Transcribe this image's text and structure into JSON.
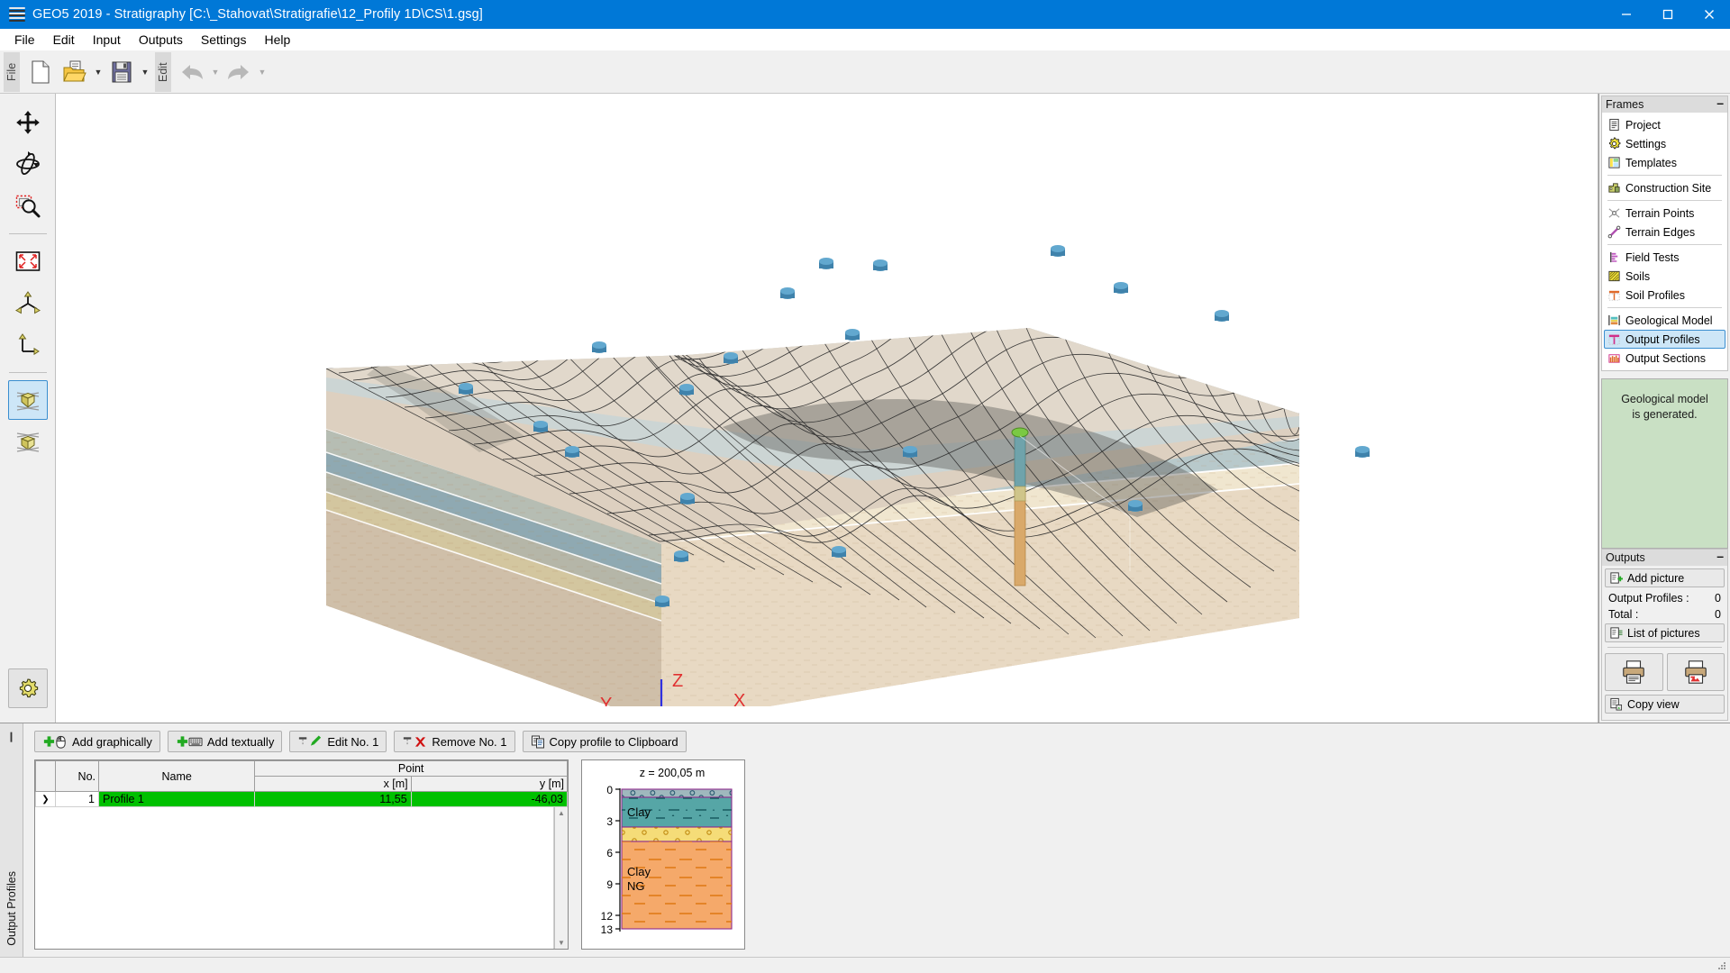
{
  "window": {
    "title": "GEO5 2019 - Stratigraphy [C:\\_Stahovat\\Stratigrafie\\12_Profily 1D\\CS\\1.gsg]",
    "app_icon": "geo5-stack-icon",
    "minimize": "—",
    "maximize": "☐",
    "close": "✕"
  },
  "menu": {
    "items": [
      "File",
      "Edit",
      "Input",
      "Outputs",
      "Settings",
      "Help"
    ]
  },
  "toolbar": {
    "groups": [
      {
        "label": "File",
        "buttons": [
          "new-file-icon",
          "open-folder-icon",
          "save-floppy-icon"
        ]
      },
      {
        "label": "Edit",
        "buttons": [
          "undo-arrow-icon",
          "redo-arrow-icon"
        ]
      }
    ]
  },
  "left_toolbar": {
    "items": [
      {
        "name": "pan-tool",
        "icon": "move-arrows-icon",
        "active": false
      },
      {
        "name": "rotate-tool",
        "icon": "rotate-3d-icon",
        "active": false
      },
      {
        "name": "zoom-window-tool",
        "icon": "zoom-window-icon",
        "active": false
      },
      {
        "name": "zoom-all-tool",
        "icon": "zoom-extents-icon",
        "active": false
      },
      {
        "name": "axonometric-view",
        "icon": "axes-3d-icon",
        "active": false
      },
      {
        "name": "plan-view",
        "icon": "axes-2d-icon",
        "active": false
      },
      {
        "name": "view-top-cut",
        "icon": "cube-top-cut-icon",
        "active": true
      },
      {
        "name": "view-full-cube",
        "icon": "cube-solid-icon",
        "active": false
      }
    ],
    "settings": {
      "name": "view-settings",
      "icon": "gear-icon"
    }
  },
  "canvas": {
    "axes": {
      "x": "X",
      "y": "Y",
      "z": "Z"
    },
    "x_color": "#e03030",
    "y_color": "#18a018",
    "z_color": "#3030e0",
    "borehole_marker_color": "#7ac943",
    "test_point_color": "#3f87b5"
  },
  "frames_panel": {
    "title": "Frames",
    "minimize": "–",
    "items": [
      {
        "label": "Project",
        "icon": "document-icon",
        "selected": false,
        "sep_after": false
      },
      {
        "label": "Settings",
        "icon": "gear-icon",
        "selected": false,
        "sep_after": false
      },
      {
        "label": "Templates",
        "icon": "template-icon",
        "selected": false,
        "sep_after": true
      },
      {
        "label": "Construction Site",
        "icon": "construction-site-icon",
        "selected": false,
        "sep_after": true
      },
      {
        "label": "Terrain Points",
        "icon": "terrain-points-icon",
        "selected": false,
        "sep_after": false
      },
      {
        "label": "Terrain Edges",
        "icon": "terrain-edges-icon",
        "selected": false,
        "sep_after": true
      },
      {
        "label": "Field Tests",
        "icon": "field-tests-icon",
        "selected": false,
        "sep_after": false
      },
      {
        "label": "Soils",
        "icon": "soils-hatch-icon",
        "selected": false,
        "sep_after": false
      },
      {
        "label": "Soil Profiles",
        "icon": "soil-profile-icon",
        "selected": false,
        "sep_after": true
      },
      {
        "label": "Geological Model",
        "icon": "geological-model-icon",
        "selected": false,
        "sep_after": false
      },
      {
        "label": "Output Profiles",
        "icon": "output-profile-icon",
        "selected": true,
        "sep_after": false
      },
      {
        "label": "Output Sections",
        "icon": "output-section-icon",
        "selected": false,
        "sep_after": false
      }
    ]
  },
  "status_message": "Geological model\nis generated.",
  "outputs_panel": {
    "title": "Outputs",
    "minimize": "–",
    "add_picture": "Add picture",
    "rows": [
      {
        "label": "Output Profiles :",
        "value": "0"
      },
      {
        "label": "Total :",
        "value": "0"
      }
    ],
    "list_of_pictures": "List of pictures",
    "print_doc_icon": "printer-document-icon",
    "print_pic_icon": "printer-picture-icon",
    "copy_view": "Copy view"
  },
  "bottom": {
    "tab_label": "Output Profiles",
    "pin_icon": "pin-icon",
    "buttons": [
      {
        "label": "Add graphically",
        "icon": "add-mouse-icon"
      },
      {
        "label": "Add textually",
        "icon": "add-keyboard-icon"
      },
      {
        "label": "Edit No. 1",
        "icon": "edit-pencil-icon"
      },
      {
        "label": "Remove No. 1",
        "icon": "remove-x-icon"
      },
      {
        "label": "Copy profile to Clipboard",
        "icon": "copy-clipboard-icon"
      }
    ],
    "table": {
      "headers": {
        "no": "No.",
        "name": "Name",
        "point": "Point",
        "x": "x [m]",
        "y": "y [m]"
      },
      "rows": [
        {
          "marker": "❯",
          "no": "1",
          "name": "Profile 1",
          "x": "11,55",
          "y": "-46,03",
          "selected": true
        }
      ]
    }
  },
  "profile_preview": {
    "elevation_label": "z = 200,05 m",
    "depth_ticks": [
      "0",
      "3",
      "6",
      "9",
      "12",
      "13"
    ],
    "layers": [
      {
        "name": "",
        "color": "#9fb8bd",
        "from": 0,
        "to": 0.45,
        "hatch": "gravel"
      },
      {
        "name": "Clay",
        "color": "#56a6a6",
        "from": 0.45,
        "to": 3.2,
        "hatch": "clay"
      },
      {
        "name": "",
        "color": "#f5dc78",
        "from": 3.2,
        "to": 4.4,
        "hatch": "sand"
      },
      {
        "name": "Clay\nNG",
        "color": "#f5a96a",
        "from": 4.4,
        "to": 13,
        "hatch": "clay"
      }
    ],
    "outline_color": "#8e2b8e"
  }
}
